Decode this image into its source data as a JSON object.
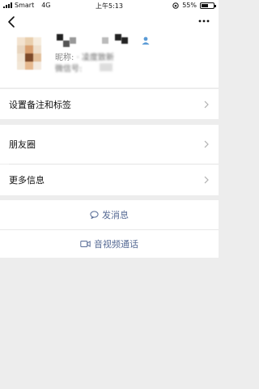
{
  "status_bar": {
    "carrier": "Smart",
    "network": "4G",
    "time": "上午5:13",
    "battery_text": "55%",
    "battery_level": 0.55
  },
  "nav": {
    "back_icon": "chevron-left-icon",
    "more_icon": "more-dots-icon"
  },
  "profile": {
    "nickname_prefix": "昵称:",
    "nickname_value": "· 凌度致新",
    "wechat_id_prefix": "微信号:",
    "gender_icon": "male-icon"
  },
  "menu": {
    "remark_tags": "设置备注和标签",
    "moments": "朋友圈",
    "more_info": "更多信息"
  },
  "actions": {
    "send_message": "发消息",
    "send_message_icon": "chat-bubble-icon",
    "video_call": "音视频通话",
    "video_call_icon": "video-camera-icon"
  },
  "colors": {
    "link": "#576b95",
    "background": "#ededed",
    "gender": "#5a9bd6"
  }
}
